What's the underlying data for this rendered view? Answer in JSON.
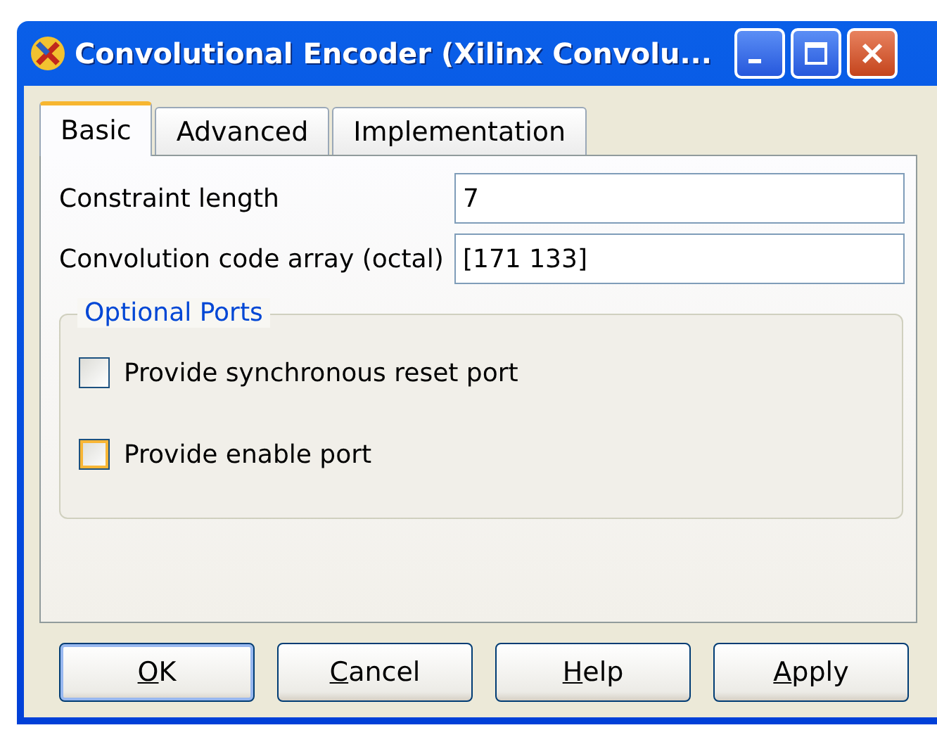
{
  "window": {
    "title": "Convolutional Encoder (Xilinx Convolu..."
  },
  "tabs": [
    {
      "label": "Basic",
      "selected": true
    },
    {
      "label": "Advanced",
      "selected": false
    },
    {
      "label": "Implementation",
      "selected": false
    }
  ],
  "fields": [
    {
      "label": "Constraint length",
      "value": "7"
    },
    {
      "label": "Convolution code array (octal)",
      "value": "[171 133]"
    }
  ],
  "group": {
    "title": "Optional Ports",
    "options": [
      {
        "label": "Provide synchronous reset port",
        "checked": false,
        "hover": false
      },
      {
        "label": "Provide enable port",
        "checked": false,
        "hover": true
      }
    ]
  },
  "buttons": [
    {
      "label": "OK",
      "default": true
    },
    {
      "label": "Cancel",
      "default": false
    },
    {
      "label": "Help",
      "default": false
    },
    {
      "label": "Apply",
      "default": false
    }
  ]
}
